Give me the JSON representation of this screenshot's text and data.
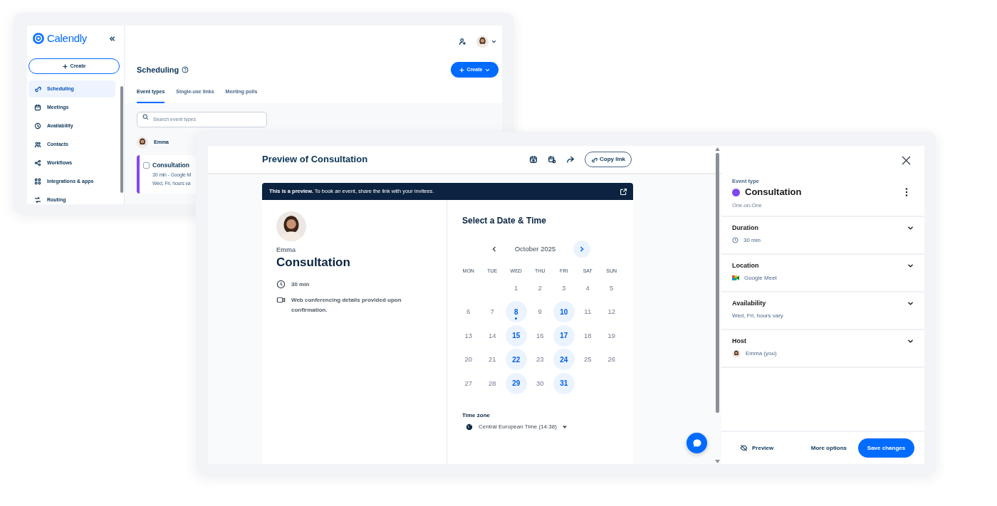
{
  "app_window": {
    "logo": "Calendly",
    "create_button": "Create",
    "sidebar": {
      "items": [
        {
          "label": "Scheduling",
          "kind": "link",
          "selected": true
        },
        {
          "label": "Meetings",
          "kind": "calendar",
          "selected": false
        },
        {
          "label": "Availability",
          "kind": "clock",
          "selected": false
        },
        {
          "label": "Contacts",
          "kind": "contacts",
          "selected": false
        },
        {
          "label": "Workflows",
          "kind": "workflow",
          "selected": false
        },
        {
          "label": "Integrations & apps",
          "kind": "grid",
          "selected": false
        },
        {
          "label": "Routing",
          "kind": "routing",
          "selected": false
        }
      ]
    },
    "header": {
      "title": "Scheduling",
      "create_button": "Create"
    },
    "tabs": [
      {
        "label": "Event types",
        "selected": true
      },
      {
        "label": "Single-use links",
        "selected": false
      },
      {
        "label": "Meeting polls",
        "selected": false
      }
    ],
    "search": {
      "placeholder": "Search event types"
    },
    "owner": {
      "name": "Emma"
    },
    "event_card": {
      "title": "Consultation",
      "color": "#8247f5",
      "details": [
        "30 min - Google M",
        "Wed, Fri, hours va"
      ]
    }
  },
  "preview_window": {
    "title": "Preview of Consultation",
    "copy_link": "Copy link",
    "banner": "**This is a preview.** To book an event, share the link with your invitees.",
    "host": "Emma",
    "event_title": "Consultation",
    "details": [
      {
        "kind": "clock",
        "text": "30 min"
      },
      {
        "kind": "video",
        "text": "Web conferencing details provided upon confirmation."
      }
    ],
    "calendar": {
      "title": "Select a Date & Time",
      "month": "October 2025",
      "weekdays": [
        "MON",
        "TUE",
        "WED",
        "THU",
        "FRI",
        "SAT",
        "SUN"
      ],
      "weeks": [
        [
          {
            "day": "1",
            "available": false,
            "today": false
          },
          {
            "day": "2",
            "available": false,
            "today": false
          },
          {
            "day": "3",
            "available": false,
            "today": false
          },
          {
            "day": "4",
            "available": false,
            "today": false
          },
          {
            "day": "5",
            "available": false,
            "today": false
          }
        ],
        [
          {
            "day": "6",
            "available": false,
            "today": false
          },
          {
            "day": "7",
            "available": false,
            "today": false
          },
          {
            "day": "8",
            "available": true,
            "today": true
          },
          {
            "day": "9",
            "available": false,
            "today": false
          },
          {
            "day": "10",
            "available": true,
            "today": false
          },
          {
            "day": "11",
            "available": false,
            "today": false
          },
          {
            "day": "12",
            "available": false,
            "today": false
          }
        ],
        [
          {
            "day": "13",
            "available": false,
            "today": false
          },
          {
            "day": "14",
            "available": false,
            "today": false
          },
          {
            "day": "15",
            "available": true,
            "today": false
          },
          {
            "day": "16",
            "available": false,
            "today": false
          },
          {
            "day": "17",
            "available": true,
            "today": false
          },
          {
            "day": "18",
            "available": false,
            "today": false
          },
          {
            "day": "19",
            "available": false,
            "today": false
          }
        ],
        [
          {
            "day": "20",
            "available": false,
            "today": false
          },
          {
            "day": "21",
            "available": false,
            "today": false
          },
          {
            "day": "22",
            "available": true,
            "today": false
          },
          {
            "day": "23",
            "available": false,
            "today": false
          },
          {
            "day": "24",
            "available": true,
            "today": false
          },
          {
            "day": "25",
            "available": false,
            "today": false
          },
          {
            "day": "26",
            "available": false,
            "today": false
          }
        ],
        [
          {
            "day": "27",
            "available": false,
            "today": false
          },
          {
            "day": "28",
            "available": false,
            "today": false
          },
          {
            "day": "29",
            "available": true,
            "today": false
          },
          {
            "day": "30",
            "available": false,
            "today": false
          },
          {
            "day": "31",
            "available": true,
            "today": false
          }
        ]
      ]
    },
    "time_zone": {
      "label": "Time zone",
      "value": "Central European Time (14:38)"
    }
  },
  "side_panel": {
    "label": "Event type",
    "title": "Consultation",
    "color": "#8247f5",
    "subtitle": "One-on-One",
    "sections": [
      {
        "title": "Duration",
        "kind": "clock",
        "value": "30 min"
      },
      {
        "title": "Location",
        "kind": "meet",
        "value": "Google Meet"
      },
      {
        "title": "Availability",
        "kind": "text",
        "value": "Wed, Fri, hours vary"
      },
      {
        "title": "Host",
        "kind": "avatar",
        "value": "Emma (you)"
      }
    ],
    "footer": {
      "preview": "Preview",
      "more_options": "More options",
      "save": "Save changes"
    }
  }
}
